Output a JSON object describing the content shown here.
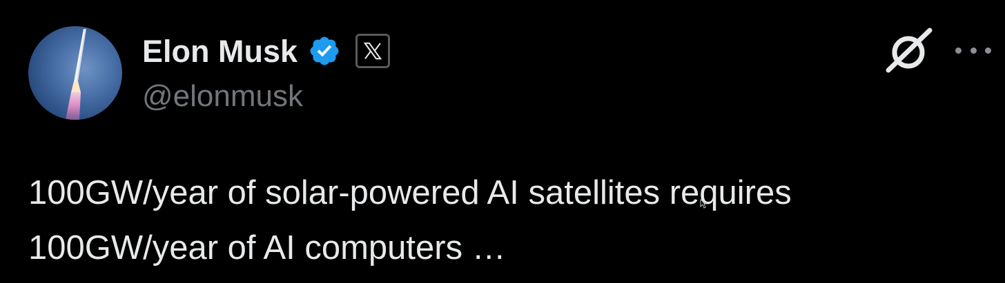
{
  "tweet": {
    "author": {
      "display_name": "Elon Musk",
      "handle": "@elonmusk",
      "verified": true,
      "avatar_icon": "rocket-launch-avatar",
      "affiliation_icon": "x-logo-icon"
    },
    "actions": {
      "grok_icon": "grok-icon",
      "more_icon": "more-options-icon"
    },
    "text": "100GW/year of solar-powered AI satellites requires\n100GW/year of AI computers …"
  },
  "colors": {
    "background": "#000000",
    "primary_text": "#e7e9ea",
    "secondary_text": "#71767b",
    "verified_blue": "#1d9bf0"
  }
}
